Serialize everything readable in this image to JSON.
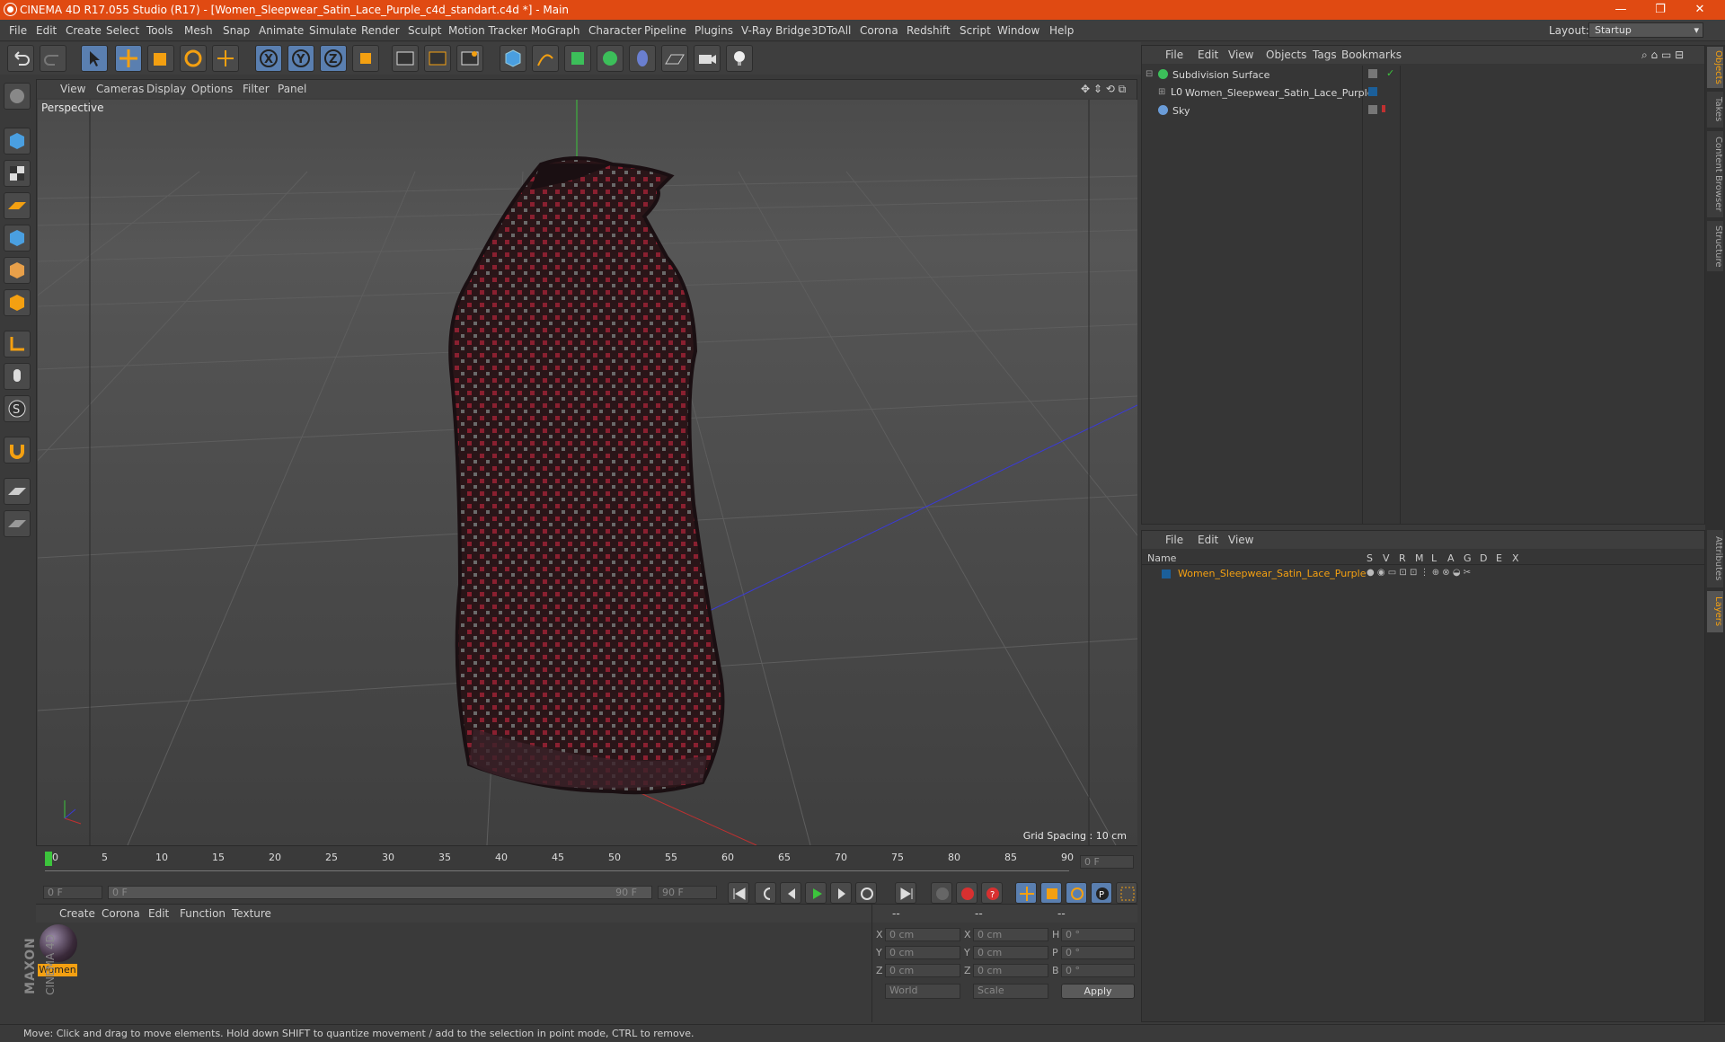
{
  "titlebar": {
    "title": "CINEMA 4D R17.055 Studio (R17) - [Women_Sleepwear_Satin_Lace_Purple_c4d_standart.c4d *] - Main",
    "min": "—",
    "restore": "❐",
    "close": "✕"
  },
  "menu": {
    "items": [
      "File",
      "Edit",
      "Create",
      "Select",
      "Tools",
      "Mesh",
      "Snap",
      "Animate",
      "Simulate",
      "Render",
      "Sculpt",
      "Motion Tracker",
      "MoGraph",
      "Character",
      "Pipeline",
      "Plugins",
      "V-Ray Bridge",
      "3DToAll",
      "Corona",
      "Redshift",
      "Script",
      "Window",
      "Help"
    ],
    "layout_label": "Layout:",
    "layout_value": "Startup"
  },
  "viewport": {
    "menu": [
      "View",
      "Cameras",
      "Display",
      "Options",
      "Filter",
      "Panel"
    ],
    "label": "Perspective",
    "grid_spacing": "Grid Spacing : 10 cm"
  },
  "timeline": {
    "ticks": [
      "0",
      "5",
      "10",
      "15",
      "20",
      "25",
      "30",
      "35",
      "40",
      "45",
      "50",
      "55",
      "60",
      "65",
      "70",
      "75",
      "80",
      "85",
      "90"
    ],
    "current_frame": "0 F",
    "start_field": "0 F",
    "range_start": "0 F",
    "range_end": "90 F",
    "end_field": "90 F"
  },
  "material_panel": {
    "menu": [
      "Create",
      "Corona",
      "Edit",
      "Function",
      "Texture"
    ],
    "material_name": "Women",
    "brand_1": "MAXON",
    "brand_2": "CINEMA 4D"
  },
  "coords": {
    "headers": [
      "--",
      "--",
      "--"
    ],
    "rows": [
      {
        "a": "X",
        "av": "0 cm",
        "b": "X",
        "bv": "0 cm",
        "c": "H",
        "cv": "0 °"
      },
      {
        "a": "Y",
        "av": "0 cm",
        "b": "Y",
        "bv": "0 cm",
        "c": "P",
        "cv": "0 °"
      },
      {
        "a": "Z",
        "av": "0 cm",
        "b": "Z",
        "bv": "0 cm",
        "c": "B",
        "cv": "0 °"
      }
    ],
    "world": "World",
    "scale": "Scale",
    "apply": "Apply"
  },
  "object_manager": {
    "menu": [
      "File",
      "Edit",
      "View",
      "Objects",
      "Tags",
      "Bookmarks"
    ],
    "objects": [
      "Subdivision Surface",
      "Women_Sleepwear_Satin_Lace_Purple",
      "Sky"
    ]
  },
  "layer_manager": {
    "menu": [
      "File",
      "Edit",
      "View"
    ],
    "name_header": "Name",
    "flags": [
      "S",
      "V",
      "R",
      "M",
      "L",
      "A",
      "G",
      "D",
      "E",
      "X"
    ],
    "layer_name": "Women_Sleepwear_Satin_Lace_Purple"
  },
  "side_tabs": [
    "Objects",
    "Takes",
    "Content Browser",
    "Structure",
    "Attributes",
    "Layers"
  ],
  "status": "Move: Click and drag to move elements. Hold down SHIFT to quantize movement / add to the selection in point mode, CTRL to remove."
}
